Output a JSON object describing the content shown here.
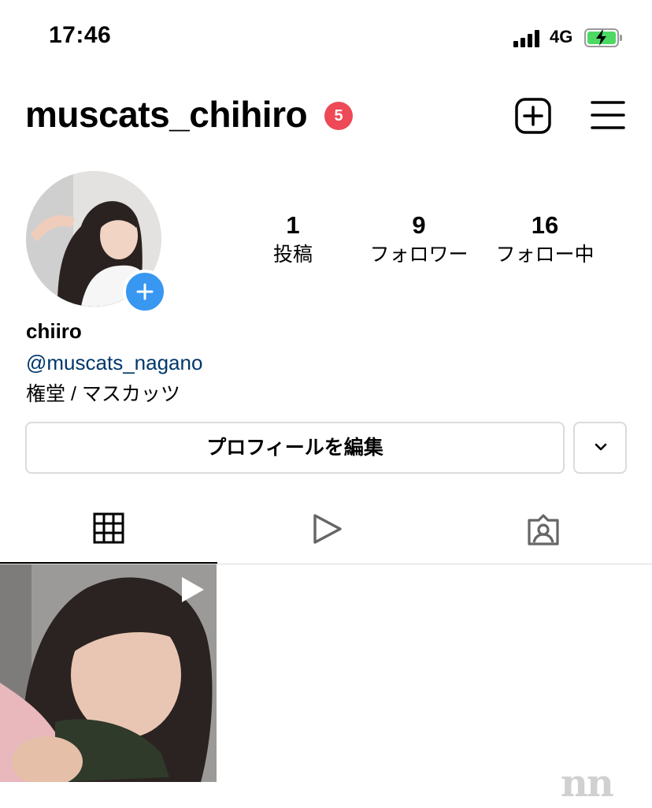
{
  "status_bar": {
    "time": "17:46",
    "network": "4G"
  },
  "header": {
    "username": "muscats_chihiro",
    "notification_count": "5"
  },
  "stats": [
    {
      "value": "1",
      "label": "投稿"
    },
    {
      "value": "9",
      "label": "フォロワー"
    },
    {
      "value": "16",
      "label": "フォロー中"
    }
  ],
  "bio": {
    "name": "chiiro",
    "link": "@muscats_nagano",
    "text": "権堂 / マスカッツ"
  },
  "actions": {
    "edit_profile": "プロフィールを編集"
  },
  "tabs": [
    {
      "icon": "grid-icon",
      "active": true
    },
    {
      "icon": "reels-icon",
      "active": false
    },
    {
      "icon": "tagged-icon",
      "active": false
    }
  ],
  "posts": [
    {
      "type": "reel"
    }
  ],
  "watermark": "nn",
  "colors": {
    "badge": "#ed4956",
    "link": "#00376b",
    "add_story": "#3897f0",
    "battery": "#4cd964",
    "border": "#dbdbdb"
  }
}
